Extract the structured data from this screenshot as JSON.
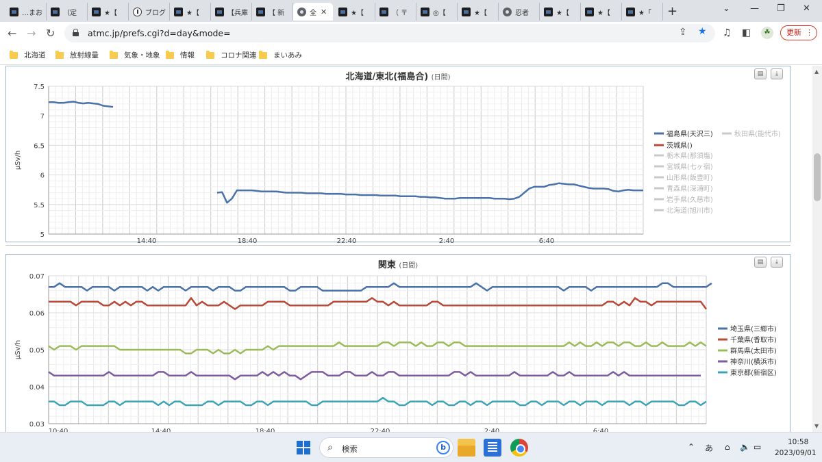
{
  "tabs": [
    {
      "title": "…まお",
      "icon": "photo-thumb-icon"
    },
    {
      "title": "（定",
      "icon": "photo-thumb-icon"
    },
    {
      "title": "★【",
      "icon": "photo-thumb-icon"
    },
    {
      "title": "ブログ",
      "icon": "info-icon"
    },
    {
      "title": "★【",
      "icon": "photo-thumb-icon"
    },
    {
      "title": "【兵庫",
      "icon": "photo-thumb-icon"
    },
    {
      "title": "【 新",
      "icon": "photo-thumb-icon"
    },
    {
      "title": "全",
      "icon": "globe-icon",
      "active": true
    },
    {
      "title": "★【",
      "icon": "photo-thumb-icon"
    },
    {
      "title": "（ 〒",
      "icon": "photo-thumb-icon"
    },
    {
      "title": "◎【",
      "icon": "photo-thumb-icon"
    },
    {
      "title": "★【",
      "icon": "photo-thumb-icon"
    },
    {
      "title": "忍者",
      "icon": "globe-icon"
    },
    {
      "title": "★【",
      "icon": "photo-thumb-icon"
    },
    {
      "title": "★【",
      "icon": "photo-thumb-icon"
    },
    {
      "title": "★「",
      "icon": "photo-thumb-icon"
    }
  ],
  "toolbar": {
    "url": "atmc.jp/prefs.cgi?d=day&mode=",
    "update_label": "更新"
  },
  "bookmarks": [
    "北海道",
    "放射線量",
    "気象・地象",
    "情報",
    "コロナ関連",
    "まいあみ"
  ],
  "taskbar": {
    "search_placeholder": "検索",
    "ime_label": "あ",
    "time": "10:58",
    "date": "2023/09/01"
  },
  "chart_data": [
    {
      "type": "line",
      "title": "北海道/東北(福島合)",
      "subtitle": "(日間)",
      "ylabel": "μSv/h",
      "ylim": [
        5,
        7.5
      ],
      "yticks": [
        "7.5",
        "7",
        "6.5",
        "6",
        "5.5",
        "5"
      ],
      "xtick_labels": [
        "14:40",
        "18:40",
        "22:40",
        "2:40",
        "6:40"
      ],
      "legend_position": "right",
      "series": [
        {
          "name": "福島県(天沢三)",
          "color": "#4a72a8",
          "active": true,
          "segments": [
            {
              "start_index": 0,
              "values": [
                7.23,
                7.23,
                7.22,
                7.22,
                7.23,
                7.24,
                7.22,
                7.21,
                7.22,
                7.21,
                7.2,
                7.17,
                7.16,
                7.15
              ]
            },
            {
              "start_index": 34,
              "values": [
                5.7,
                5.71,
                5.53,
                5.6,
                5.74,
                5.74,
                5.74,
                5.74,
                5.73,
                5.72,
                5.72,
                5.72,
                5.72,
                5.71,
                5.7,
                5.7,
                5.7,
                5.7,
                5.69,
                5.69,
                5.69,
                5.69,
                5.68,
                5.68,
                5.68,
                5.68,
                5.67,
                5.67,
                5.67,
                5.66,
                5.66,
                5.66,
                5.66,
                5.65,
                5.65,
                5.65,
                5.65,
                5.64,
                5.64,
                5.64,
                5.64,
                5.63,
                5.63,
                5.62,
                5.62,
                5.61,
                5.6,
                5.6,
                5.6,
                5.61,
                5.61,
                5.61,
                5.61,
                5.61,
                5.61,
                5.61,
                5.6,
                5.6,
                5.6,
                5.59,
                5.6,
                5.63,
                5.7,
                5.77,
                5.8,
                5.8,
                5.8,
                5.83,
                5.84,
                5.86,
                5.85,
                5.84,
                5.84,
                5.82,
                5.8,
                5.78,
                5.77,
                5.77,
                5.77,
                5.76,
                5.73,
                5.72,
                5.74,
                5.75,
                5.74,
                5.74,
                5.74
              ]
            }
          ]
        },
        {
          "name": "茨城県()",
          "color": "#b94a3a",
          "active": true
        },
        {
          "name": "栃木県(那須塩)",
          "color": "#c9c9c9"
        },
        {
          "name": "宮城県(七ヶ宿)",
          "color": "#c9c9c9"
        },
        {
          "name": "山形県(飯豊町)",
          "color": "#c9c9c9"
        },
        {
          "name": "青森県(深浦町)",
          "color": "#c9c9c9"
        },
        {
          "name": "岩手県(久慈市)",
          "color": "#c9c9c9"
        },
        {
          "name": "北海道(旭川市)",
          "color": "#c9c9c9"
        },
        {
          "name": "秋田県(能代市)",
          "color": "#c9c9c9"
        }
      ]
    },
    {
      "type": "line",
      "title": "関東",
      "subtitle": "(日間)",
      "ylabel": "μSv/h",
      "ylim": [
        0.03,
        0.07
      ],
      "yticks": [
        "0.07",
        "0.06",
        "0.05",
        "0.04",
        "0.03"
      ],
      "xtick_labels": [
        "10:40",
        "14:40",
        "18:40",
        "22:40",
        "2:40",
        "6:40"
      ],
      "legend_position": "right",
      "series": [
        {
          "name": "埼玉県(三郷市)",
          "color": "#4a72a8",
          "base": 0.067
        },
        {
          "name": "千葉県(香取市)",
          "color": "#b94a3a",
          "base": 0.0625
        },
        {
          "name": "群馬県(太田市)",
          "color": "#9bbb59",
          "base": 0.0505
        },
        {
          "name": "神奈川(横浜市)",
          "color": "#7e5aa0",
          "base": 0.0433
        },
        {
          "name": "東京都(新宿区)",
          "color": "#3ba3b8",
          "base": 0.0357
        }
      ]
    }
  ]
}
